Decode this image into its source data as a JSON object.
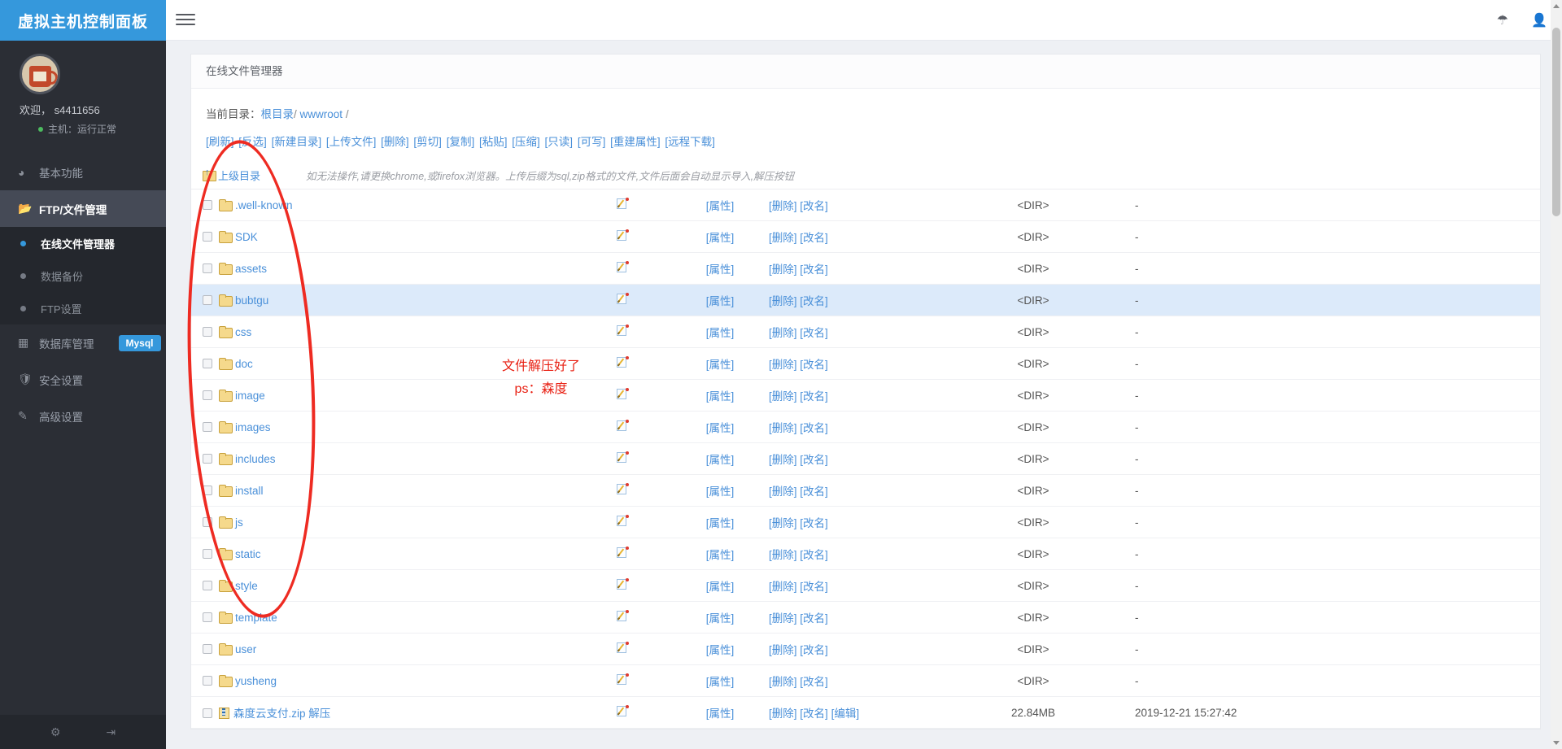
{
  "brand": {
    "title": "虚拟主机控制面板"
  },
  "topbar": {
    "menu_icon": "hamburger-icon",
    "support_icon": "headset-icon",
    "user_icon": "user-icon"
  },
  "profile": {
    "welcome": "欢迎， s4411656",
    "status": "主机：运行正常",
    "status_color": "#4cbb5f"
  },
  "sidebar": {
    "items": [
      {
        "label": "基本功能",
        "icon": "dashboard-icon",
        "active": false
      },
      {
        "label": "FTP/文件管理",
        "icon": "folder-open-icon",
        "active": true
      },
      {
        "label": "数据库管理",
        "icon": "table-icon",
        "badge": "Mysql",
        "active": false
      },
      {
        "label": "安全设置",
        "icon": "shield-icon",
        "active": false
      },
      {
        "label": "高级设置",
        "icon": "edit-square-icon",
        "active": false
      }
    ],
    "sub_items": [
      {
        "label": "在线文件管理器",
        "active": true
      },
      {
        "label": "数据备份",
        "active": false
      },
      {
        "label": "FTP设置",
        "active": false
      }
    ],
    "footer_icons": [
      "gear-icon",
      "logout-icon"
    ]
  },
  "panel": {
    "title": "在线文件管理器",
    "cwd_label": "当前目录：",
    "cwd_parts": [
      {
        "text": "根目录",
        "link": true
      },
      {
        "text": "/",
        "link": false
      },
      {
        "text": "wwwroot",
        "link": true
      },
      {
        "text": "/",
        "link": false
      }
    ],
    "toolbar": [
      "[刷新]",
      "[反选]",
      "[新建目录]",
      "[上传文件]",
      "[删除]",
      "[剪切]",
      "[复制]",
      "[粘贴]",
      "[压缩]",
      "[只读]",
      "[可写]",
      "[重建属性]",
      "[远程下载]"
    ],
    "up_dir": "上级目录",
    "hint": "如无法操作,请更换chrome,或firefox浏览器。上传后缀为sql,zip格式的文件,文件后面会自动显示导入,解压按钮",
    "ops": {
      "attr": "[属性]",
      "delete": "[删除]",
      "rename": "[改名]",
      "edit": "[编辑]"
    },
    "dir_marker": "<DIR>",
    "empty_size": "-"
  },
  "files": [
    {
      "name": ".well-known",
      "type": "dir",
      "size": "<DIR>",
      "time": "-",
      "selected": false,
      "extra_op": null
    },
    {
      "name": "SDK",
      "type": "dir",
      "size": "<DIR>",
      "time": "-",
      "selected": false,
      "extra_op": null
    },
    {
      "name": "assets",
      "type": "dir",
      "size": "<DIR>",
      "time": "-",
      "selected": false,
      "extra_op": null
    },
    {
      "name": "bubtgu",
      "type": "dir",
      "size": "<DIR>",
      "time": "-",
      "selected": true,
      "extra_op": null
    },
    {
      "name": "css",
      "type": "dir",
      "size": "<DIR>",
      "time": "-",
      "selected": false,
      "extra_op": null
    },
    {
      "name": "doc",
      "type": "dir",
      "size": "<DIR>",
      "time": "-",
      "selected": false,
      "extra_op": null
    },
    {
      "name": "image",
      "type": "dir",
      "size": "<DIR>",
      "time": "-",
      "selected": false,
      "extra_op": null
    },
    {
      "name": "images",
      "type": "dir",
      "size": "<DIR>",
      "time": "-",
      "selected": false,
      "extra_op": null
    },
    {
      "name": "includes",
      "type": "dir",
      "size": "<DIR>",
      "time": "-",
      "selected": false,
      "extra_op": null
    },
    {
      "name": "install",
      "type": "dir",
      "size": "<DIR>",
      "time": "-",
      "selected": false,
      "extra_op": null
    },
    {
      "name": "js",
      "type": "dir",
      "size": "<DIR>",
      "time": "-",
      "selected": false,
      "extra_op": null
    },
    {
      "name": "static",
      "type": "dir",
      "size": "<DIR>",
      "time": "-",
      "selected": false,
      "extra_op": null
    },
    {
      "name": "style",
      "type": "dir",
      "size": "<DIR>",
      "time": "-",
      "selected": false,
      "extra_op": null
    },
    {
      "name": "template",
      "type": "dir",
      "size": "<DIR>",
      "time": "-",
      "selected": false,
      "extra_op": null
    },
    {
      "name": "user",
      "type": "dir",
      "size": "<DIR>",
      "time": "-",
      "selected": false,
      "extra_op": null
    },
    {
      "name": "yusheng",
      "type": "dir",
      "size": "<DIR>",
      "time": "-",
      "selected": false,
      "extra_op": null
    },
    {
      "name": "森度云支付.zip 解压",
      "type": "zip",
      "size": "22.84MB",
      "time": "2019-12-21 15:27:42",
      "selected": false,
      "extra_op": "[编辑]"
    }
  ],
  "annotations": {
    "oval_color": "#ee2b22",
    "note_line1": "文件解压好了",
    "note_line2": "ps：森度",
    "note_color": "#e81f12"
  }
}
